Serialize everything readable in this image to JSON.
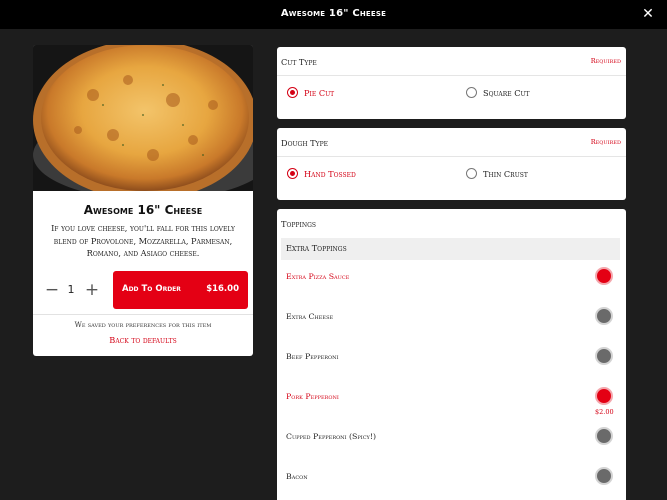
{
  "header": {
    "title": "Awesome 16\" Cheese",
    "close_icon": "close-icon"
  },
  "item": {
    "name": "Awesome 16\" Cheese",
    "description": "If you love cheese, you'll fall for this lovely blend of Provolone, Mozzarella, Parmesan, Romano, and Asiago cheese.",
    "image": "pizza-photo",
    "quantity": "1",
    "add_label": "Add To Order",
    "price": "$16.00",
    "saved_note": "We saved your preferences for this item",
    "back_link": "Back to defaults"
  },
  "cut_type": {
    "title": "Cut Type",
    "required": "Required",
    "options": [
      {
        "label": "Pie Cut",
        "selected": true
      },
      {
        "label": "Square Cut",
        "selected": false
      }
    ]
  },
  "dough_type": {
    "title": "Dough Type",
    "required": "Required",
    "options": [
      {
        "label": "Hand Tossed",
        "selected": true
      },
      {
        "label": "Thin Crust",
        "selected": false
      }
    ]
  },
  "toppings": {
    "title": "Toppings",
    "group": "Extra Toppings",
    "items": [
      {
        "label": "Extra Pizza Sauce",
        "selected": true,
        "price": ""
      },
      {
        "label": "Extra Cheese",
        "selected": false,
        "price": ""
      },
      {
        "label": "Beef Pepperoni",
        "selected": false,
        "price": ""
      },
      {
        "label": "Pork Pepperoni",
        "selected": true,
        "price": "$2.00"
      },
      {
        "label": "Cupped Pepperoni (Spicy!)",
        "selected": false,
        "price": ""
      },
      {
        "label": "Bacon",
        "selected": false,
        "price": ""
      }
    ]
  },
  "colors": {
    "accent": "#e40014",
    "background": "#1d1d1d",
    "topbar": "#000000"
  }
}
